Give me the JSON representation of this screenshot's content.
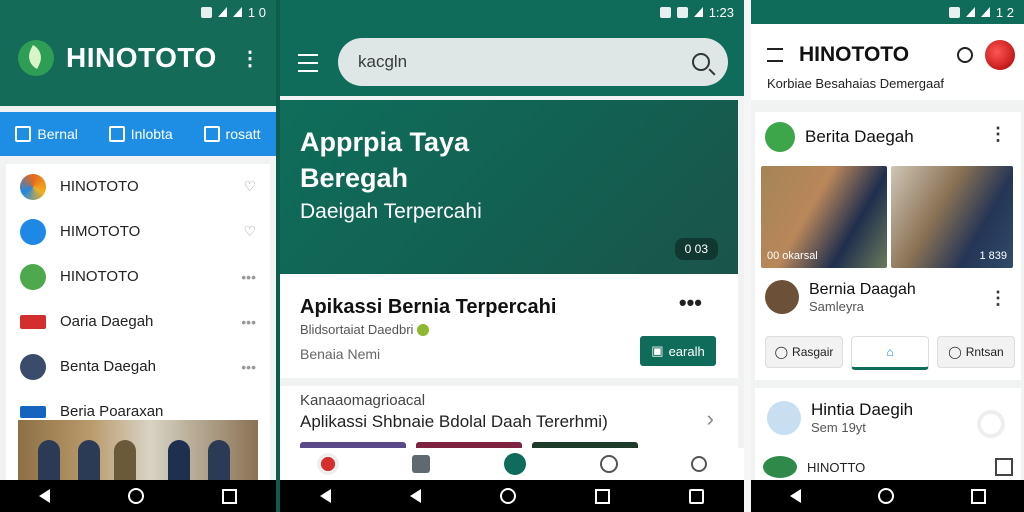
{
  "panel1": {
    "status_time": "1 0",
    "brand": "HINOTOTO",
    "tabs": [
      {
        "label": "Bernal",
        "icon": "warning-icon"
      },
      {
        "label": "Inlobta",
        "icon": "chat-icon"
      },
      {
        "label": "rosatt",
        "icon": "comment-icon"
      }
    ],
    "list": [
      {
        "label": "HINOTOTO",
        "color": "#e8671b"
      },
      {
        "label": "HIMOTOTO",
        "color": "#1e88e5"
      },
      {
        "label": "HINOTOTO",
        "color": "#4ea84d"
      },
      {
        "label": "Oaria Daegah",
        "color": "#d32f2f"
      },
      {
        "label": "Benta Daegah",
        "color": "#3b4b6b"
      },
      {
        "label": "Beria Poaraxan",
        "color": "#1565c0"
      }
    ]
  },
  "panel2": {
    "status_time": "1:23",
    "search_placeholder": "kacgln",
    "hero": {
      "title": "Apprpia Taya Beregah",
      "subtitle": "Daeigah Terpercahi",
      "badge": "0 03"
    },
    "card1": {
      "title": "Apikassi Bernia Terpercahi",
      "meta": "Blidsortaiat Daedbri",
      "tag": "Benaia Nemi",
      "button": "earalh"
    },
    "card2": {
      "caption": "Kanaaomagrioacal",
      "title": "Aplikassi Shbnaie Bdolal Daah Tererhmi)",
      "thumbs": [
        "#5a4a8a",
        "#7d2340",
        "#1e3a2a"
      ]
    }
  },
  "panel3": {
    "status_time": "1 2",
    "brand": "HINOTOTO",
    "sub": "Korbiae Besahaias Demergaaf",
    "card": {
      "title": "Berita Daegah",
      "photo_left_label": "00 okarsal",
      "photo_right_label": "1 839",
      "author": "Bernia Daagah",
      "author_sub": "Samleyra",
      "actions": [
        "Rasgair",
        "",
        "Rntsan"
      ]
    },
    "card2": {
      "name": "Hintia Daegih",
      "sub": "Sem 19yt",
      "footer": "HINOTTO"
    }
  }
}
